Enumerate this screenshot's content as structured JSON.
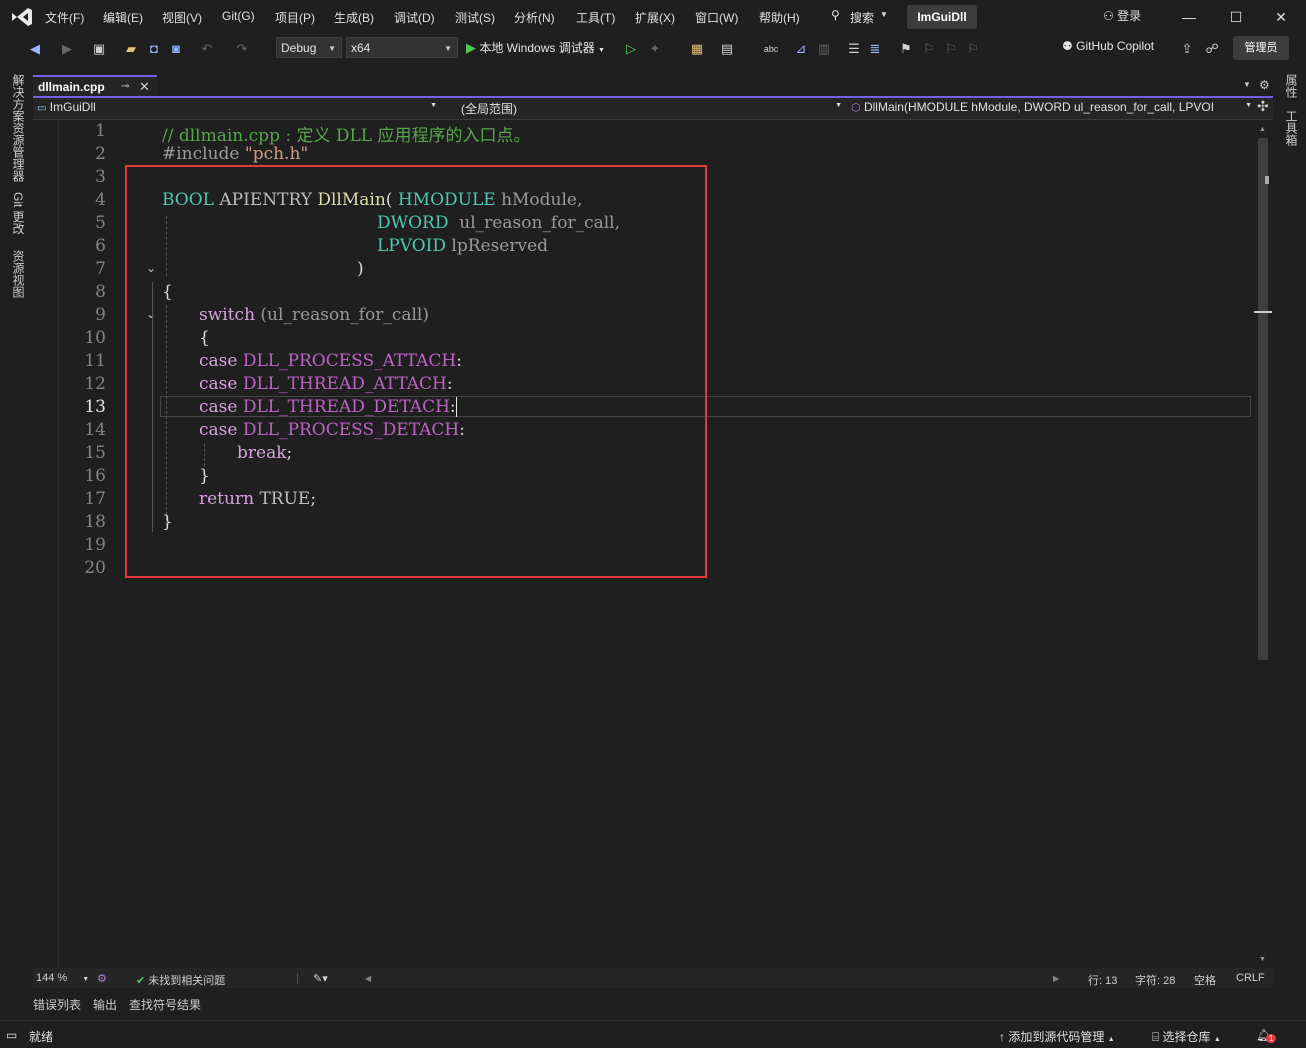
{
  "menu": {
    "items": [
      "文件(F)",
      "编辑(E)",
      "视图(V)",
      "Git(G)",
      "项目(P)",
      "生成(B)",
      "调试(D)",
      "测试(S)",
      "分析(N)",
      "工具(T)",
      "扩展(X)",
      "窗口(W)",
      "帮助(H)"
    ],
    "search_label": "搜索",
    "project_name": "ImGuiDll",
    "signin_label": "登录"
  },
  "toolbar": {
    "config": "Debug",
    "platform": "x64",
    "run_label": "本地 Windows 调试器",
    "copilot_label": "GitHub Copilot",
    "admin_label": "管理员"
  },
  "side_tabs": {
    "left": [
      "解决方案资源管理器",
      "Git 更改",
      "资源视图"
    ],
    "right": [
      "属性",
      "工具箱"
    ]
  },
  "document": {
    "tab_name": "dllmain.cpp"
  },
  "nav": {
    "project": "ImGuiDll",
    "scope": "(全局范围)",
    "member": "DllMain(HMODULE hModule, DWORD ul_reason_for_call, LPVOI"
  },
  "code": {
    "line_numbers": [
      "1",
      "2",
      "3",
      "4",
      "5",
      "6",
      "7",
      "8",
      "9",
      "10",
      "11",
      "12",
      "13",
      "14",
      "15",
      "16",
      "17",
      "18",
      "19",
      "20"
    ],
    "active_line": 13,
    "l1_comment": "// dllmain.cpp : 定义 DLL 应用程序的入口点。",
    "l2_include": "#include",
    "l2_file": "\"pch.h\"",
    "l4_type": "BOOL",
    "l4_apientry": "APIENTRY",
    "l4_fn": "DllMain",
    "l4_paren": "(",
    "l4_ptype": "HMODULE",
    "l4_pname": "hModule,",
    "l5_ptype": "DWORD",
    "l5_pname": "ul_reason_for_call,",
    "l6_ptype": "LPVOID",
    "l6_pname": "lpReserved",
    "l7": ")",
    "l8": "{",
    "l9_kw": "switch",
    "l9_rest": "(ul_reason_for_call)",
    "l10": "{",
    "l11_kw": "case",
    "l11_val": "DLL_PROCESS_ATTACH",
    "l12_kw": "case",
    "l12_val": "DLL_THREAD_ATTACH",
    "l13_kw": "case",
    "l13_val": "DLL_THREAD_DETACH",
    "l14_kw": "case",
    "l14_val": "DLL_PROCESS_DETACH",
    "l15_kw": "break",
    "l16": "}",
    "l17_kw": "return",
    "l17_val": "TRUE",
    "l18": "}"
  },
  "editor_status": {
    "zoom": "144 %",
    "issues": "未找到相关问题",
    "line": "行: 13",
    "char": "字符: 28",
    "whitespace": "空格",
    "eol": "CRLF"
  },
  "tool_tabs": [
    "错误列表",
    "输出",
    "查找符号结果"
  ],
  "status": {
    "ready": "就绪",
    "add_source": "添加到源代码管理",
    "select_repo": "选择仓库",
    "notifications": "1"
  }
}
